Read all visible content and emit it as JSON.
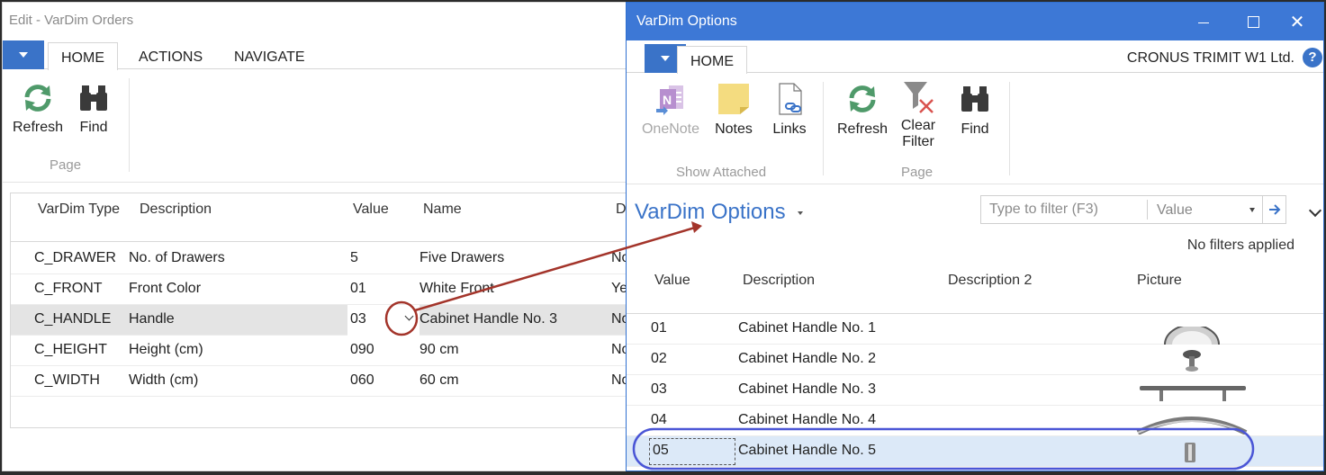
{
  "left_window": {
    "title": "Edit - VarDim Orders",
    "tabs": [
      "HOME",
      "ACTIONS",
      "NAVIGATE"
    ],
    "ribbon": {
      "refresh": "Refresh",
      "find": "Find",
      "group_page": "Page"
    },
    "columns": [
      "VarDim Type",
      "Description",
      "Value",
      "Name",
      "D"
    ],
    "rows": [
      {
        "type": "C_DRAWER",
        "description": "No. of Drawers",
        "value": "5",
        "name": "Five Drawers",
        "d": "No"
      },
      {
        "type": "C_FRONT",
        "description": "Front Color",
        "value": "01",
        "name": "White Front",
        "d": "Ye"
      },
      {
        "type": "C_HANDLE",
        "description": "Handle",
        "value": "03",
        "name": "Cabinet Handle No. 3",
        "d": "No"
      },
      {
        "type": "C_HEIGHT",
        "description": "Height (cm)",
        "value": "090",
        "name": "90 cm",
        "d": "No"
      },
      {
        "type": "C_WIDTH",
        "description": "Width (cm)",
        "value": "060",
        "name": "60 cm",
        "d": "No"
      }
    ]
  },
  "right_window": {
    "title": "VarDim Options",
    "tab": "HOME",
    "company": "CRONUS TRIMIT W1 Ltd.",
    "help": "?",
    "ribbon": {
      "onenote": "OneNote",
      "notes": "Notes",
      "links": "Links",
      "group_show_attached": "Show Attached",
      "refresh": "Refresh",
      "clear_filter_1": "Clear",
      "clear_filter_2": "Filter",
      "find": "Find",
      "group_page": "Page"
    },
    "page_title": "VarDim Options",
    "filter": {
      "placeholder": "Type to filter (F3)",
      "field": "Value",
      "status": "No filters applied"
    },
    "columns": [
      "Value",
      "Description",
      "Description 2",
      "Picture"
    ],
    "rows": [
      {
        "value": "01",
        "description": "Cabinet Handle No. 1"
      },
      {
        "value": "02",
        "description": "Cabinet Handle No. 2"
      },
      {
        "value": "03",
        "description": "Cabinet Handle No. 3"
      },
      {
        "value": "04",
        "description": "Cabinet Handle No. 4"
      },
      {
        "value": "05",
        "description": "Cabinet Handle No. 5"
      }
    ]
  },
  "colors": {
    "accent_blue": "#3d78d6",
    "annotation_red": "#a3342a",
    "selection_outline": "#4a55d6"
  },
  "icons": [
    "app-menu-icon",
    "refresh-icon",
    "find-binoculars-icon",
    "onenote-icon",
    "notes-icon",
    "links-icon",
    "clear-filter-icon",
    "help-icon",
    "minimize-icon",
    "maximize-icon",
    "close-icon",
    "dropdown-chevron-icon",
    "filter-go-arrow-icon"
  ]
}
